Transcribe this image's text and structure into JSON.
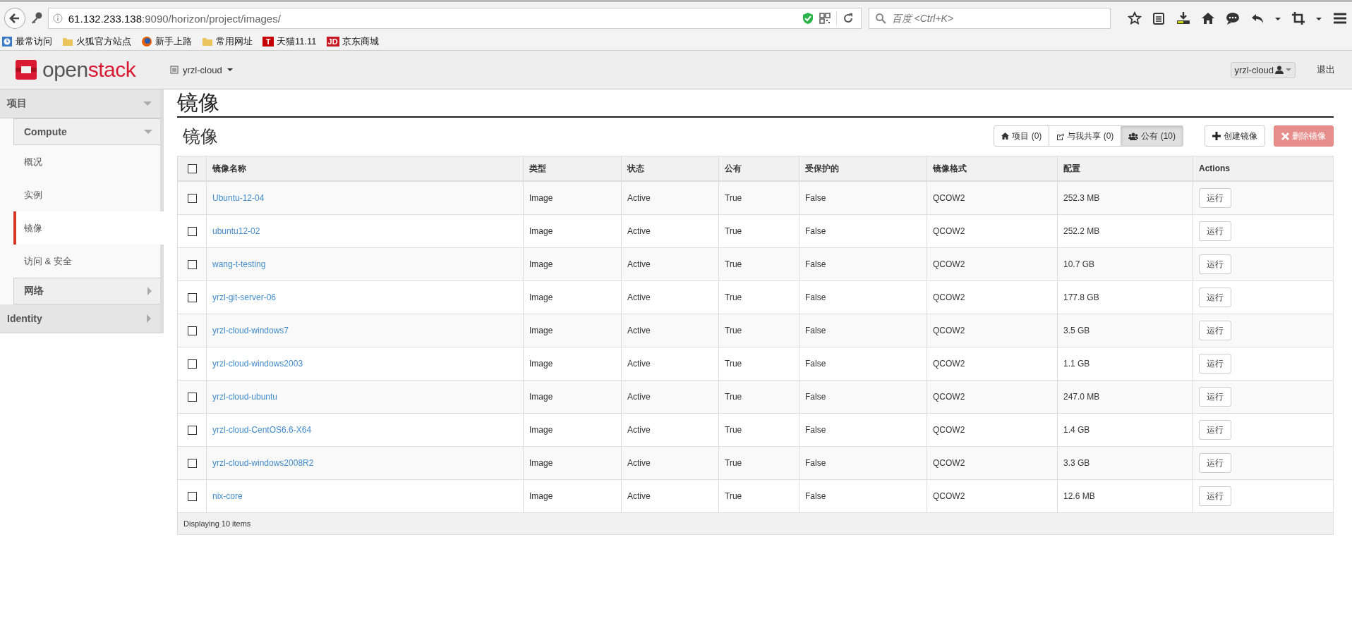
{
  "browser": {
    "url_host": "61.132.233.138",
    "url_rest": ":9090/horizon/project/images/",
    "search_placeholder": "百度 <Ctrl+K>",
    "bookmarks": [
      {
        "label": "最常访问",
        "kind": "recent"
      },
      {
        "label": "火狐官方站点",
        "kind": "folder"
      },
      {
        "label": "新手上路",
        "kind": "globe"
      },
      {
        "label": "常用网址",
        "kind": "folder"
      },
      {
        "label": "天猫11.11",
        "kind": "badge",
        "badge": "T",
        "color": "#c40000"
      },
      {
        "label": "京东商城",
        "kind": "badge",
        "badge": "JD",
        "color": "#c81623"
      }
    ]
  },
  "header": {
    "logo_prefix": "open",
    "logo_suffix": "stack",
    "project_menu": "yrzl-cloud",
    "user_menu": "yrzl-cloud",
    "sign_out": "退出"
  },
  "sidebar": [
    {
      "label": "项目",
      "expanded": true,
      "children": [
        {
          "label": "Compute",
          "expanded": true,
          "children": [
            {
              "label": "概况",
              "selected": false
            },
            {
              "label": "实例",
              "selected": false
            },
            {
              "label": "镜像",
              "selected": true
            },
            {
              "label": "访问 & 安全",
              "selected": false
            }
          ]
        },
        {
          "label": "网络",
          "expanded": false
        }
      ]
    },
    {
      "label": "Identity",
      "expanded": false
    }
  ],
  "page": {
    "title": "镜像",
    "subtitle": "镜像",
    "filters": [
      {
        "label": "项目 (0)",
        "kind": "project",
        "selected": false
      },
      {
        "label": "与我共享 (0)",
        "kind": "shared",
        "selected": false
      },
      {
        "label": "公有 (10)",
        "kind": "public",
        "selected": true
      }
    ],
    "actions": [
      {
        "label": "创建镜像",
        "kind": "create",
        "disabled": false
      },
      {
        "label": "删除镜像",
        "kind": "delete",
        "disabled": true
      }
    ]
  },
  "table": {
    "select_all_checked": false,
    "columns": [
      "镜像名称",
      "类型",
      "状态",
      "公有",
      "受保护的",
      "镜像格式",
      "配置",
      "Actions"
    ],
    "rows": [
      {
        "checked": false,
        "cells": [
          "Ubuntu-12-04",
          "Image",
          "Active",
          "True",
          "False",
          "QCOW2",
          "252.3 MB"
        ],
        "action": "运行"
      },
      {
        "checked": false,
        "cells": [
          "ubuntu12-02",
          "Image",
          "Active",
          "True",
          "False",
          "QCOW2",
          "252.2 MB"
        ],
        "action": "运行"
      },
      {
        "checked": false,
        "cells": [
          "wang-t-testing",
          "Image",
          "Active",
          "True",
          "False",
          "QCOW2",
          "10.7 GB"
        ],
        "action": "运行"
      },
      {
        "checked": false,
        "cells": [
          "yrzl-git-server-06",
          "Image",
          "Active",
          "True",
          "False",
          "QCOW2",
          "177.8 GB"
        ],
        "action": "运行"
      },
      {
        "checked": false,
        "cells": [
          "yrzl-cloud-windows7",
          "Image",
          "Active",
          "True",
          "False",
          "QCOW2",
          "3.5 GB"
        ],
        "action": "运行"
      },
      {
        "checked": false,
        "cells": [
          "yrzl-cloud-windows2003",
          "Image",
          "Active",
          "True",
          "False",
          "QCOW2",
          "1.1 GB"
        ],
        "action": "运行"
      },
      {
        "checked": false,
        "cells": [
          "yrzl-cloud-ubuntu",
          "Image",
          "Active",
          "True",
          "False",
          "QCOW2",
          "247.0 MB"
        ],
        "action": "运行"
      },
      {
        "checked": false,
        "cells": [
          "yrzl-cloud-CentOS6.6-X64",
          "Image",
          "Active",
          "True",
          "False",
          "QCOW2",
          "1.4 GB"
        ],
        "action": "运行"
      },
      {
        "checked": false,
        "cells": [
          "yrzl-cloud-windows2008R2",
          "Image",
          "Active",
          "True",
          "False",
          "QCOW2",
          "3.3 GB"
        ],
        "action": "运行"
      },
      {
        "checked": false,
        "cells": [
          "nix-core",
          "Image",
          "Active",
          "True",
          "False",
          "QCOW2",
          "12.6 MB"
        ],
        "action": "运行"
      }
    ],
    "footer": "Displaying 10 items"
  }
}
